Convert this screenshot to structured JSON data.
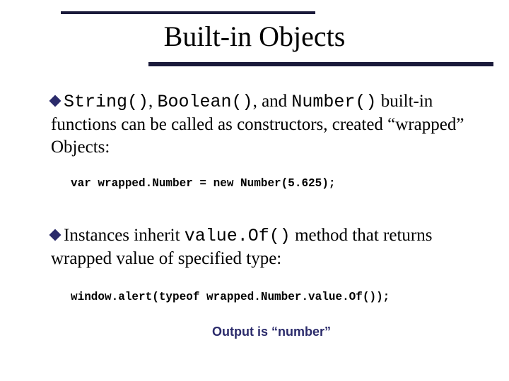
{
  "title": "Built-in Objects",
  "bullets": {
    "first": {
      "code1": "String()",
      "sep1": ", ",
      "code2": "Boolean()",
      "sep2": ", and ",
      "code3": "Number()",
      "tail": " built-in functions can be called as constructors, created “wrapped” Objects:"
    },
    "second": {
      "lead": "Instances inherit ",
      "code": "value.Of()",
      "tail": " method that returns wrapped value of specified type:"
    }
  },
  "code_lines": {
    "first": "var wrapped.Number = new Number(5.625);",
    "second": "window.alert(typeof wrapped.Number.value.Of());"
  },
  "output_note": "Output is “number”"
}
